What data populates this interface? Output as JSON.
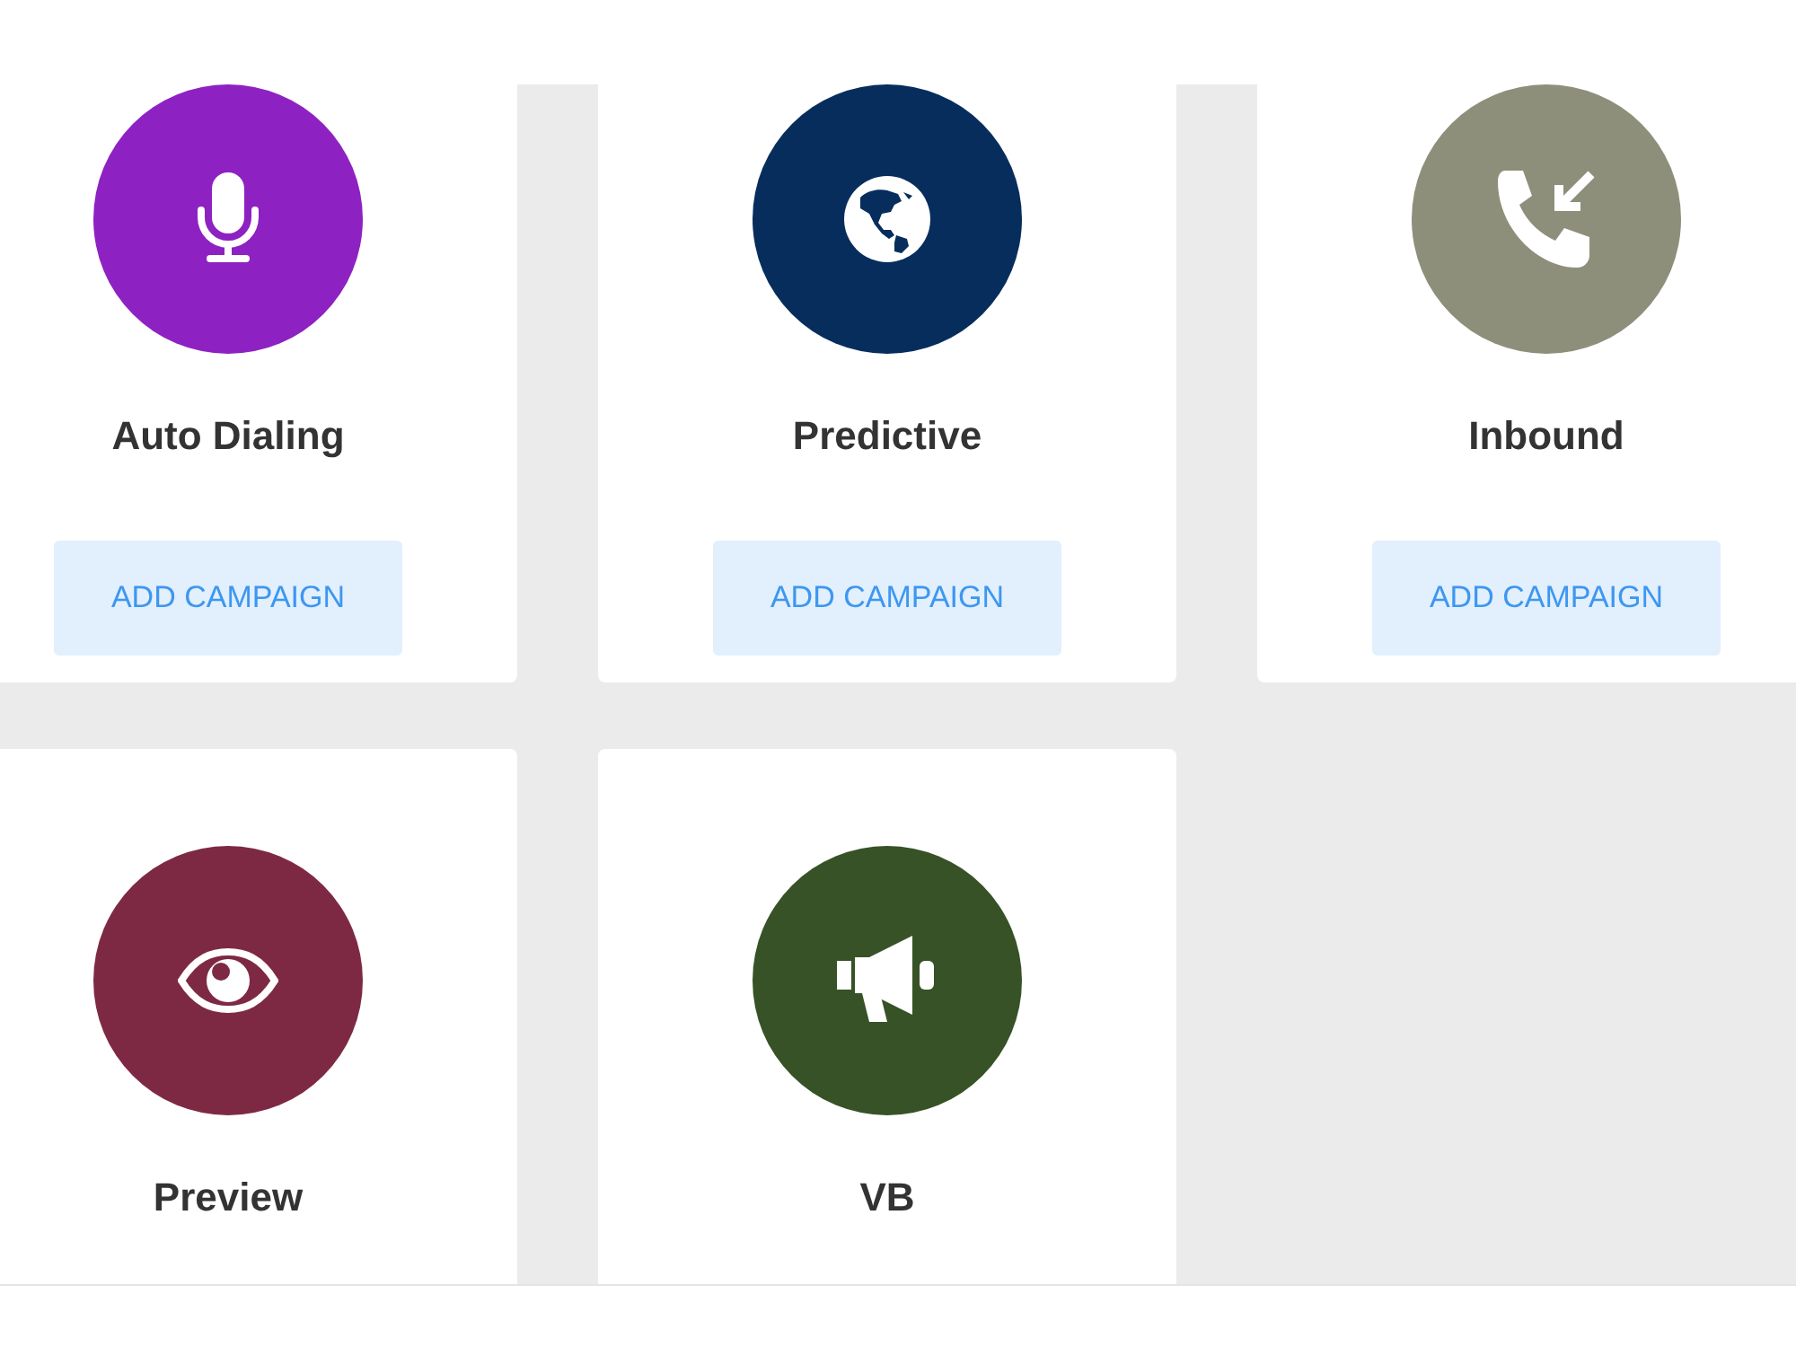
{
  "cards": [
    {
      "title": "Auto Dialing",
      "color": "#8e21c2",
      "kind": "microphone",
      "button": "ADD CAMPAIGN"
    },
    {
      "title": "Predictive",
      "color": "#062d5c",
      "kind": "globe",
      "button": "ADD CAMPAIGN"
    },
    {
      "title": "Inbound",
      "color": "#8e8f7b",
      "kind": "phone-incoming",
      "button": "ADD CAMPAIGN"
    },
    {
      "title": "Preview",
      "color": "#7e2944",
      "kind": "eye"
    },
    {
      "title": "VB",
      "color": "#375226",
      "kind": "megaphone"
    }
  ]
}
